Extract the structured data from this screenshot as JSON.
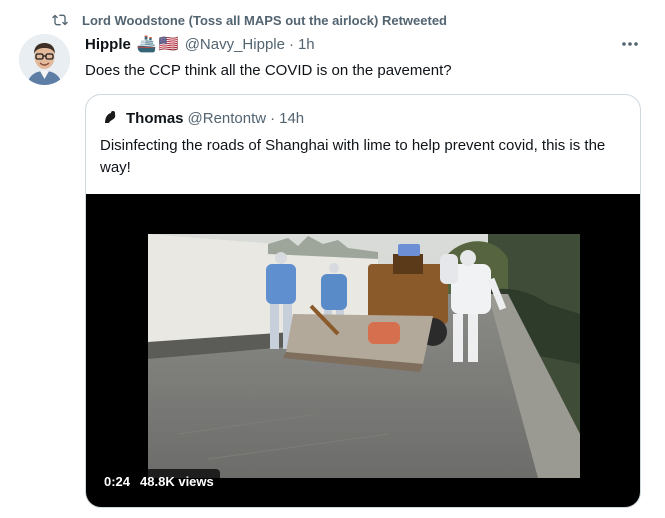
{
  "retweet": {
    "text": "Lord Woodstone (Toss all MAPS out the airlock) Retweeted",
    "icon": "retweet-icon"
  },
  "tweet": {
    "display_name": "Hipple",
    "emojis": [
      "🚢",
      "🇺🇸"
    ],
    "handle": "@Navy_Hipple",
    "separator": "·",
    "time": "1h",
    "text": "Does the CCP think all the COVID is on the pavement?",
    "more_icon": "more-icon"
  },
  "quote": {
    "display_name": "Thomas",
    "handle": "@Rentontw",
    "separator": "·",
    "time": "14h",
    "text": "Disinfecting the roads of Shanghai with lime to help prevent covid, this is the way!",
    "video": {
      "duration": "0:24",
      "views": "48.8K views"
    }
  },
  "colors": {
    "text_primary": "#0f1419",
    "text_secondary": "#536471",
    "border": "#cfd9de",
    "video_bg": "#000000"
  }
}
